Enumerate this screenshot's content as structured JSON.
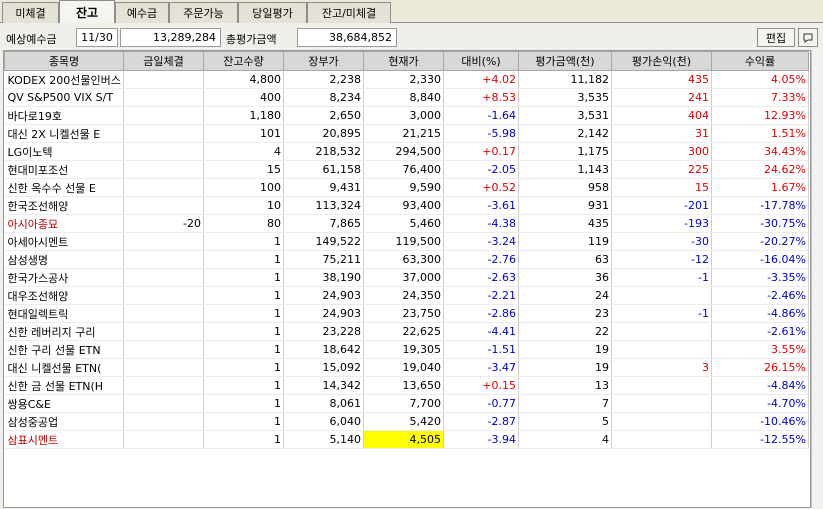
{
  "tabs": [
    "미체결",
    "잔고",
    "예수금",
    "주문가능",
    "당일평가",
    "잔고/미체결"
  ],
  "active_tab": "잔고",
  "info": {
    "expected_deposit_label": "예상예수금",
    "date": "11/30",
    "expected_deposit": "13,289,284",
    "total_eval_label": "총평가금액",
    "total_eval": "38,684,852",
    "edit_label": "편집"
  },
  "headers": [
    "종목명",
    "금일체결",
    "잔고수량",
    "장부가",
    "현재가",
    "대비(%)",
    "평가금액(천)",
    "평가손익(천)",
    "수익률"
  ],
  "rows": [
    {
      "name": "KODEX 200선물인버스",
      "today": "",
      "qty": "4,800",
      "book": "2,238",
      "cur": "2,330",
      "chg": "+4.02",
      "eval": "11,182",
      "pl": "435",
      "ret": "4.05%"
    },
    {
      "name": "QV S&P500 VIX S/T",
      "today": "",
      "qty": "400",
      "book": "8,234",
      "cur": "8,840",
      "chg": "+8.53",
      "eval": "3,535",
      "pl": "241",
      "ret": "7.33%"
    },
    {
      "name": "바다로19호",
      "today": "",
      "qty": "1,180",
      "book": "2,650",
      "cur": "3,000",
      "chg": "-1.64",
      "eval": "3,531",
      "pl": "404",
      "ret": "12.93%"
    },
    {
      "name": "대신 2X 니켈선물 E",
      "today": "",
      "qty": "101",
      "book": "20,895",
      "cur": "21,215",
      "chg": "-5.98",
      "eval": "2,142",
      "pl": "31",
      "ret": "1.51%"
    },
    {
      "name": "LG이노텍",
      "today": "",
      "qty": "4",
      "book": "218,532",
      "cur": "294,500",
      "chg": "+0.17",
      "eval": "1,175",
      "pl": "300",
      "ret": "34.43%"
    },
    {
      "name": "현대미포조선",
      "today": "",
      "qty": "15",
      "book": "61,158",
      "cur": "76,400",
      "chg": "-2.05",
      "eval": "1,143",
      "pl": "225",
      "ret": "24.62%"
    },
    {
      "name": "신한 옥수수 선물 E",
      "today": "",
      "qty": "100",
      "book": "9,431",
      "cur": "9,590",
      "chg": "+0.52",
      "eval": "958",
      "pl": "15",
      "ret": "1.67%"
    },
    {
      "name": "한국조선해양",
      "today": "",
      "qty": "10",
      "book": "113,324",
      "cur": "93,400",
      "chg": "-3.61",
      "eval": "931",
      "pl": "-201",
      "ret": "-17.78%"
    },
    {
      "name": "아시아종묘",
      "today": "-20",
      "qty": "80",
      "book": "7,865",
      "cur": "5,460",
      "chg": "-4.38",
      "eval": "435",
      "pl": "-193",
      "ret": "-30.75%",
      "name_color": "darkred"
    },
    {
      "name": "아세아시멘트",
      "today": "",
      "qty": "1",
      "book": "149,522",
      "cur": "119,500",
      "chg": "-3.24",
      "eval": "119",
      "pl": "-30",
      "ret": "-20.27%"
    },
    {
      "name": "삼성생명",
      "today": "",
      "qty": "1",
      "book": "75,211",
      "cur": "63,300",
      "chg": "-2.76",
      "eval": "63",
      "pl": "-12",
      "ret": "-16.04%"
    },
    {
      "name": "한국가스공사",
      "today": "",
      "qty": "1",
      "book": "38,190",
      "cur": "37,000",
      "chg": "-2.63",
      "eval": "36",
      "pl": "-1",
      "ret": "-3.35%"
    },
    {
      "name": "대우조선해양",
      "today": "",
      "qty": "1",
      "book": "24,903",
      "cur": "24,350",
      "chg": "-2.21",
      "eval": "24",
      "pl": "",
      "ret": "-2.46%"
    },
    {
      "name": "현대일렉트릭",
      "today": "",
      "qty": "1",
      "book": "24,903",
      "cur": "23,750",
      "chg": "-2.86",
      "eval": "23",
      "pl": "-1",
      "ret": "-4.86%"
    },
    {
      "name": "신한 레버리지 구리",
      "today": "",
      "qty": "1",
      "book": "23,228",
      "cur": "22,625",
      "chg": "-4.41",
      "eval": "22",
      "pl": "",
      "ret": "-2.61%"
    },
    {
      "name": "신한 구리 선물 ETN",
      "today": "",
      "qty": "1",
      "book": "18,642",
      "cur": "19,305",
      "chg": "-1.51",
      "eval": "19",
      "pl": "",
      "ret": "3.55%"
    },
    {
      "name": "대신 니켈선물 ETN(",
      "today": "",
      "qty": "1",
      "book": "15,092",
      "cur": "19,040",
      "chg": "-3.47",
      "eval": "19",
      "pl": "3",
      "ret": "26.15%"
    },
    {
      "name": "신한 금 선물 ETN(H",
      "today": "",
      "qty": "1",
      "book": "14,342",
      "cur": "13,650",
      "chg": "+0.15",
      "eval": "13",
      "pl": "",
      "ret": "-4.84%"
    },
    {
      "name": "쌍용C&E",
      "today": "",
      "qty": "1",
      "book": "8,061",
      "cur": "7,700",
      "chg": "-0.77",
      "eval": "7",
      "pl": "",
      "ret": "-4.70%"
    },
    {
      "name": "삼성중공업",
      "today": "",
      "qty": "1",
      "book": "6,040",
      "cur": "5,420",
      "chg": "-2.87",
      "eval": "5",
      "pl": "",
      "ret": "-10.46%"
    },
    {
      "name": "삼표시멘트",
      "today": "",
      "qty": "1",
      "book": "5,140",
      "cur": "4,505",
      "chg": "-3.94",
      "eval": "4",
      "pl": "",
      "ret": "-12.55%",
      "name_color": "darkred",
      "cur_highlight": true
    }
  ],
  "colors": {
    "up": "#e00000",
    "down": "#0000c8",
    "highlight": "#ffff00"
  }
}
